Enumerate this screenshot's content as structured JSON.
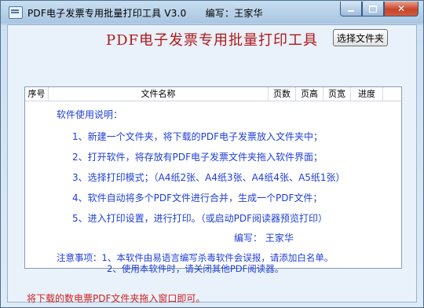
{
  "window": {
    "title": "PDF电子发票专用批量打印工具 V3.0      编写：王家华"
  },
  "main": {
    "header_title": "PDF电子发票专用批量打印工具",
    "select_folder_button": "选择文件夹"
  },
  "table": {
    "columns": [
      "序号",
      "文件名称",
      "页数",
      "页高",
      "页宽",
      "进度"
    ],
    "instructions": {
      "heading": "软件使用说明：",
      "steps": [
        "1、新建一个文件夹，将下载的PDF电子发票放入文件夹中；",
        "2、打开软件，将存放有PDF电子发票文件夹拖入软件界面；",
        "3、选择打印模式；（A4纸2张、A4纸3张、A4纸4张、A5纸1张）",
        "4、软件自动将多个PDF文件进行合并，生成一个PDF文件；",
        "5、进入打印设置，进行打印。（或启动PDF阅读器预览打印）"
      ],
      "author": "编写：  王家华",
      "notes": [
        "注意事项：1、本软件由易语言编写杀毒软件会误报，请添加白名单。",
        "2、使用本软件时，请关闭其他PDF阅读器。"
      ]
    }
  },
  "footer": {
    "hint": "将下载的数电票PDF文件夹拖入窗口即可。"
  },
  "colors": {
    "title_red": "#b01818",
    "instruction_blue": "#1f3fd8",
    "hint_red": "#cc2222"
  },
  "icons": [
    "app-icon",
    "minimize-icon",
    "maximize-icon",
    "close-icon"
  ]
}
